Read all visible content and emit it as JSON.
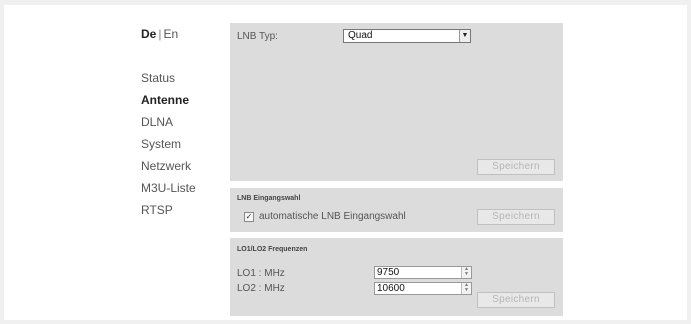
{
  "lang": {
    "de": "De",
    "sep": "|",
    "en": "En"
  },
  "nav": [
    "Status",
    "Antenne",
    "DLNA",
    "System",
    "Netzwerk",
    "M3U-Liste",
    "RTSP"
  ],
  "lnb_type": {
    "label": "LNB Typ:",
    "value": "Quad",
    "arrow_icon": "▼",
    "save": "Speichern"
  },
  "lnb_input": {
    "title": "LNB Eingangswahl",
    "checkbox_label": "automatische LNB Eingangswahl",
    "checked": true,
    "check_mark": "✓",
    "save": "Speichern"
  },
  "lo": {
    "title": "LO1/LO2 Frequenzen",
    "lo1_label": "LO1 : MHz",
    "lo1_value": "9750",
    "lo2_label": "LO2 : MHz",
    "lo2_value": "10600",
    "spin_up": "▲",
    "spin_down": "▼",
    "save": "Speichern"
  }
}
